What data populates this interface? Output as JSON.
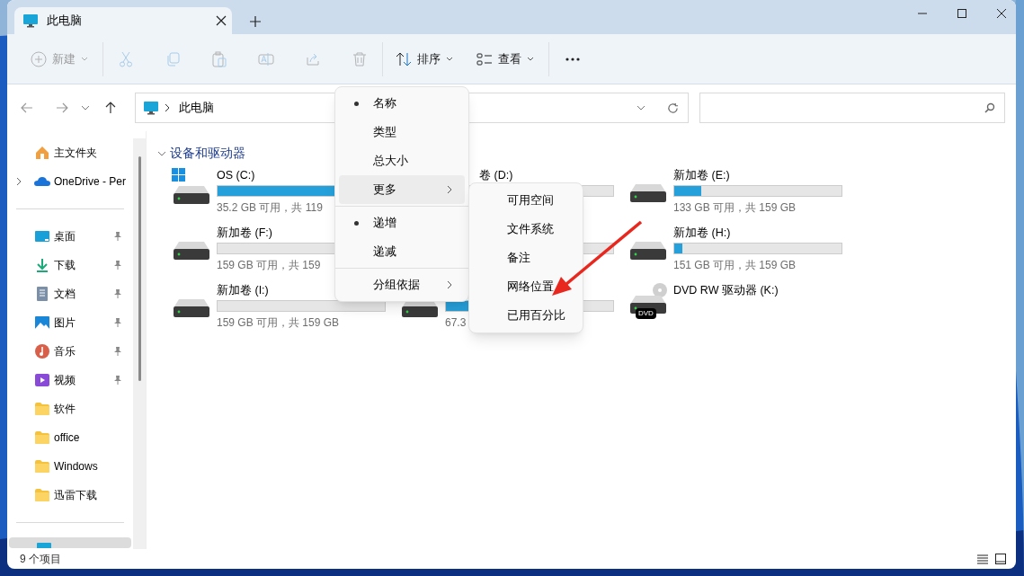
{
  "window": {
    "tab_title": "此电脑"
  },
  "toolbar": {
    "items": [
      {
        "kind": "new",
        "label": "新建",
        "disabled": true
      },
      {
        "kind": "cut",
        "disabled": true
      },
      {
        "kind": "copy",
        "disabled": true
      },
      {
        "kind": "paste",
        "disabled": true
      },
      {
        "kind": "rename",
        "disabled": true
      },
      {
        "kind": "share",
        "disabled": true
      },
      {
        "kind": "delete",
        "disabled": true
      },
      {
        "kind": "sort",
        "label": "排序",
        "disabled": false
      },
      {
        "kind": "view",
        "label": "查看",
        "disabled": false
      },
      {
        "kind": "more",
        "disabled": false
      }
    ]
  },
  "address_bar": {
    "path": "此电脑"
  },
  "sidebar": {
    "items": [
      {
        "kind": "home",
        "label": "主文件夹",
        "pinned": false,
        "selected": false
      },
      {
        "kind": "cloud",
        "label": "OneDrive - Per",
        "pinned": false,
        "selected": false,
        "expandable": true
      },
      {
        "kind": "desktop",
        "label": "桌面",
        "pinned": true,
        "selected": false
      },
      {
        "kind": "download",
        "label": "下载",
        "pinned": true,
        "selected": false
      },
      {
        "kind": "document",
        "label": "文档",
        "pinned": true,
        "selected": false
      },
      {
        "kind": "picture",
        "label": "图片",
        "pinned": true,
        "selected": false
      },
      {
        "kind": "music",
        "label": "音乐",
        "pinned": true,
        "selected": false
      },
      {
        "kind": "video",
        "label": "视频",
        "pinned": true,
        "selected": false
      },
      {
        "kind": "folder",
        "label": "软件",
        "pinned": false,
        "selected": false
      },
      {
        "kind": "folder",
        "label": "office",
        "pinned": false,
        "selected": false
      },
      {
        "kind": "folder",
        "label": "Windows",
        "pinned": false,
        "selected": false
      },
      {
        "kind": "folder",
        "label": "迅雷下载",
        "pinned": false,
        "selected": false
      },
      {
        "kind": "computer",
        "pinned": false,
        "selected": true
      }
    ]
  },
  "content": {
    "section_title": "设备和驱动器",
    "drives": [
      {
        "kind": "system",
        "name": "OS (C:)",
        "level": 0.7,
        "usage": "35.2 GB 可用，共 119"
      },
      {
        "kind": "disk",
        "name": "卷 (D:)"
      },
      {
        "kind": "disk",
        "name": "新加卷 (E:)",
        "level": 0.16,
        "usage": "133 GB 可用，共 159 GB"
      },
      {
        "kind": "disk",
        "name": "新加卷 (F:)",
        "level": 0,
        "usage": "159 GB 可用，共 159"
      },
      {
        "kind": "disk"
      },
      {
        "kind": "disk",
        "name": "新加卷 (H:)",
        "level": 0.05,
        "usage": "151 GB 可用，共 159 GB"
      },
      {
        "kind": "disk",
        "name": "新加卷 (I:)",
        "level": 0,
        "usage": "159 GB 可用，共 159 GB"
      },
      {
        "kind": "disk",
        "level": 0.58,
        "usage": "67.3"
      },
      {
        "kind": "dvd",
        "name": "DVD RW 驱动器 (K:)",
        "badge": "DVD"
      }
    ]
  },
  "sort_menu": {
    "items": [
      {
        "kind": "option",
        "label": "名称",
        "selected": true
      },
      {
        "kind": "option",
        "label": "类型",
        "selected": false
      },
      {
        "kind": "option",
        "label": "总大小",
        "selected": false
      },
      {
        "kind": "submenu",
        "label": "更多",
        "selected": false,
        "hovered": true
      },
      {
        "kind": "separator"
      },
      {
        "kind": "option",
        "label": "递增",
        "selected": true
      },
      {
        "kind": "option",
        "label": "递减",
        "selected": false
      },
      {
        "kind": "separator"
      },
      {
        "kind": "submenu",
        "label": "分组依据",
        "selected": false,
        "hovered": false
      }
    ]
  },
  "more_submenu": {
    "items": [
      {
        "label": "可用空间"
      },
      {
        "label": "文件系统"
      },
      {
        "label": "备注"
      },
      {
        "label": "网络位置"
      },
      {
        "label": "已用百分比"
      }
    ]
  },
  "status_bar": {
    "item_count": "9 个项目",
    "views": [
      {
        "kind": "details",
        "selected": false
      },
      {
        "kind": "tiles",
        "selected": false
      }
    ]
  }
}
